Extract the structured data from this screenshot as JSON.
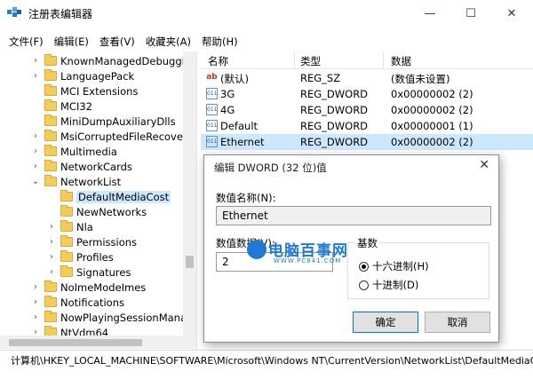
{
  "window": {
    "title": "注册表编辑器"
  },
  "menu": [
    "文件(F)",
    "编辑(E)",
    "查看(V)",
    "收藏夹(A)",
    "帮助(H)"
  ],
  "tree": {
    "items": [
      {
        "label": "KnownManagedDebuggingD",
        "level": 0,
        "expandable": true
      },
      {
        "label": "LanguagePack",
        "level": 0,
        "expandable": true
      },
      {
        "label": "MCI Extensions",
        "level": 0,
        "expandable": false
      },
      {
        "label": "MCI32",
        "level": 0,
        "expandable": false
      },
      {
        "label": "MiniDumpAuxiliaryDlls",
        "level": 0,
        "expandable": false
      },
      {
        "label": "MsiCorruptedFileRecovery",
        "level": 0,
        "expandable": true
      },
      {
        "label": "Multimedia",
        "level": 0,
        "expandable": true
      },
      {
        "label": "NetworkCards",
        "level": 0,
        "expandable": true
      },
      {
        "label": "NetworkList",
        "level": 0,
        "expanded": true
      },
      {
        "label": "DefaultMediaCost",
        "level": 1,
        "expandable": false,
        "selected": true
      },
      {
        "label": "NewNetworks",
        "level": 1,
        "expandable": false
      },
      {
        "label": "Nla",
        "level": 1,
        "expandable": true
      },
      {
        "label": "Permissions",
        "level": 1,
        "expandable": true
      },
      {
        "label": "Profiles",
        "level": 1,
        "expandable": true
      },
      {
        "label": "Signatures",
        "level": 1,
        "expandable": true
      },
      {
        "label": "NoImeModeImes",
        "level": 0,
        "expandable": true
      },
      {
        "label": "Notifications",
        "level": 0,
        "expandable": true
      },
      {
        "label": "NowPlayingSessionManager",
        "level": 0,
        "expandable": true
      },
      {
        "label": "NtVdm64",
        "level": 0,
        "expandable": true
      }
    ]
  },
  "list": {
    "headers": {
      "name": "名称",
      "type": "类型",
      "data": "数据"
    },
    "rows": [
      {
        "icon": "ab",
        "name": "(默认)",
        "type": "REG_SZ",
        "data": "(数值未设置)"
      },
      {
        "icon": "011",
        "name": "3G",
        "type": "REG_DWORD",
        "data": "0x00000002 (2)"
      },
      {
        "icon": "011",
        "name": "4G",
        "type": "REG_DWORD",
        "data": "0x00000002 (2)"
      },
      {
        "icon": "011",
        "name": "Default",
        "type": "REG_DWORD",
        "data": "0x00000001 (1)"
      },
      {
        "icon": "011",
        "name": "Ethernet",
        "type": "REG_DWORD",
        "data": "0x00000002 (2)",
        "selected": true
      }
    ]
  },
  "status": "计算机\\HKEY_LOCAL_MACHINE\\SOFTWARE\\Microsoft\\Windows NT\\CurrentVersion\\NetworkList\\DefaultMediaCc",
  "dialog": {
    "title": "编辑 DWORD (32 位)值",
    "name_label": "数值名称(N):",
    "name_value": "Ethernet",
    "data_label": "数值数据(V):",
    "data_value": "2",
    "base_label": "基数",
    "hex_label": "十六进制(H)",
    "dec_label": "十进制(D)",
    "ok": "确定",
    "cancel": "取消"
  },
  "watermark": {
    "text": "电脑百事网",
    "url": "WWW.PC841.COM"
  }
}
